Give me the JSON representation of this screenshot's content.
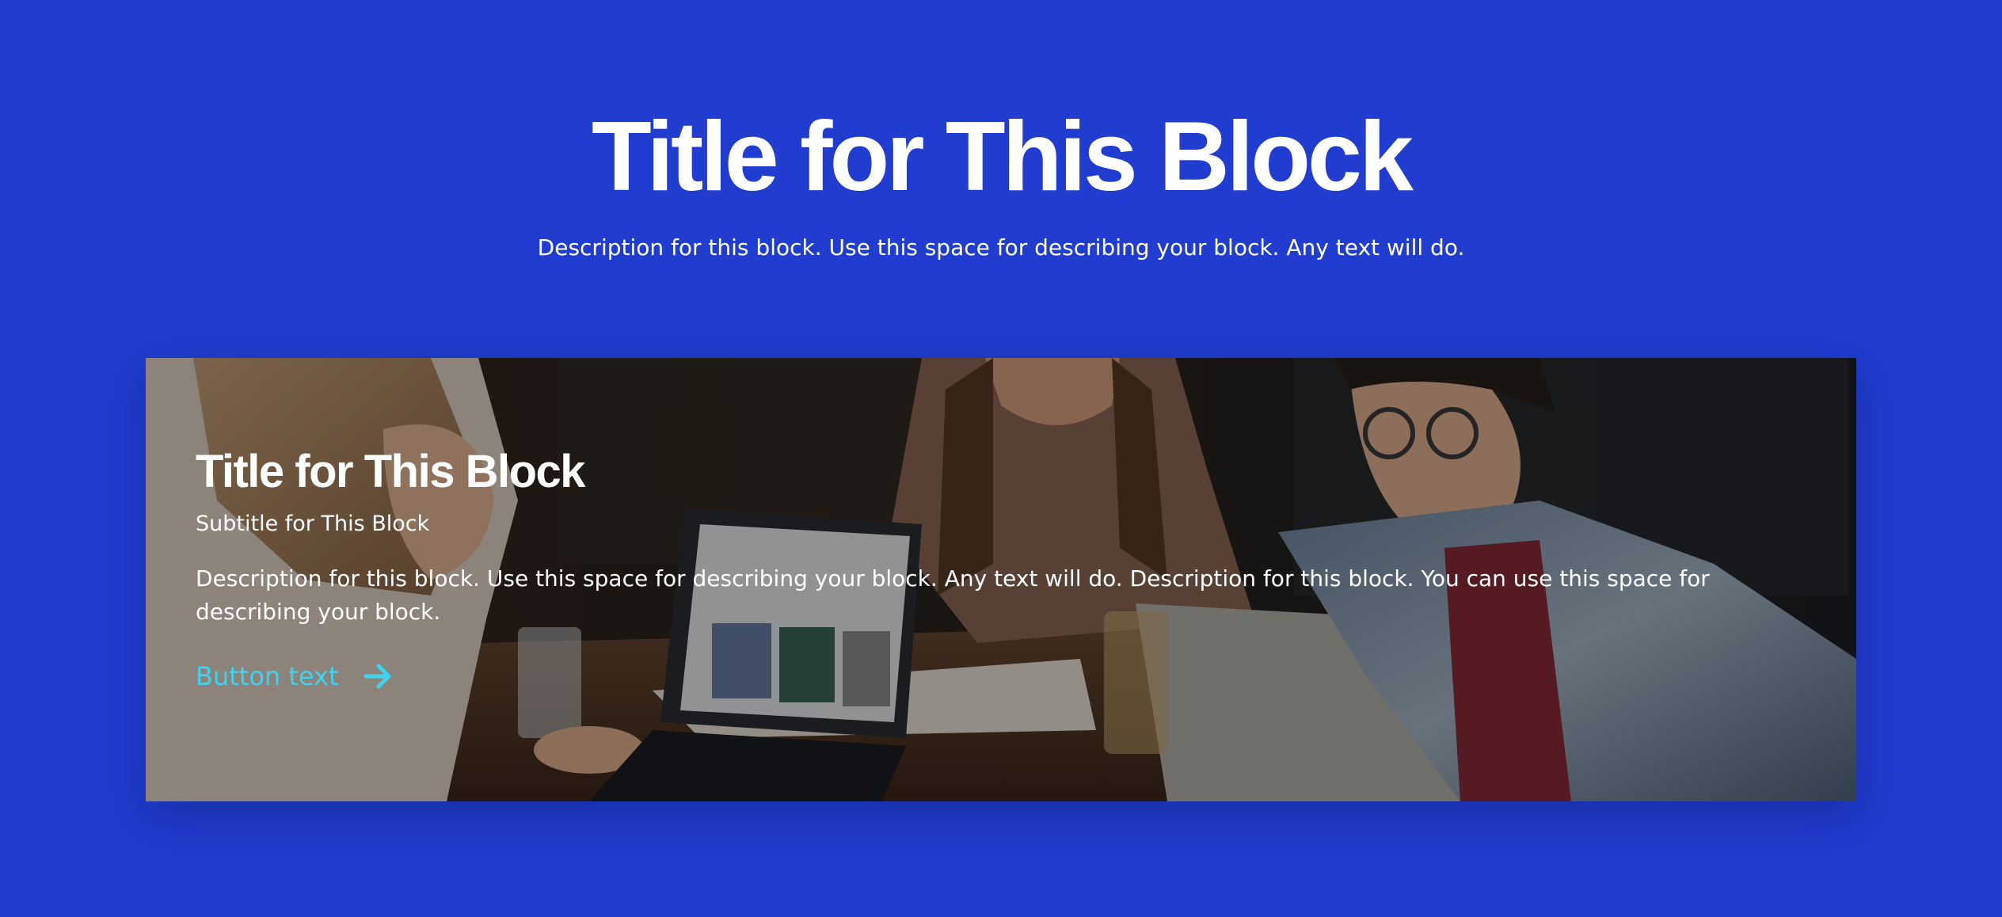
{
  "header": {
    "title": "Title for This Block",
    "description": "Description for this block. Use this space for describing your block. Any text will do."
  },
  "card": {
    "image_alt": "Three people smiling around a table with laptops",
    "title": "Title for This Block",
    "subtitle": "Subtitle for This Block",
    "description": "Description for this block. Use this space for describing your block. Any text will do. Description for this block. You can use this space for describing your block.",
    "button_label": "Button text",
    "button_icon": "arrow-right-icon"
  },
  "colors": {
    "background": "#203dd0",
    "accent": "#3fd3f0",
    "text": "#ffffff"
  }
}
